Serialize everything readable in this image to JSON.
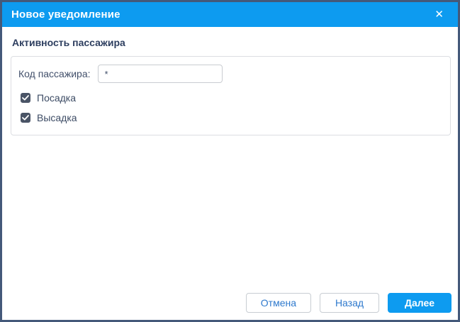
{
  "dialog": {
    "title": "Новое уведомление",
    "close_icon": "✕"
  },
  "body": {
    "section_title": "Активность пассажира",
    "form": {
      "passenger_code_label": "Код пассажира:",
      "passenger_code_value": "*",
      "checkboxes": [
        {
          "label": "Посадка",
          "checked": true
        },
        {
          "label": "Высадка",
          "checked": true
        }
      ]
    }
  },
  "footer": {
    "cancel_label": "Отмена",
    "back_label": "Назад",
    "next_label": "Далее"
  },
  "colors": {
    "header_blue": "#0d9bf0",
    "primary_button_blue": "#0d9bf0",
    "dialog_border": "#44597a",
    "heading_text": "#2d3e5f",
    "checkbox_fill": "#4a5466",
    "outline_button_text": "#2e79cd"
  }
}
